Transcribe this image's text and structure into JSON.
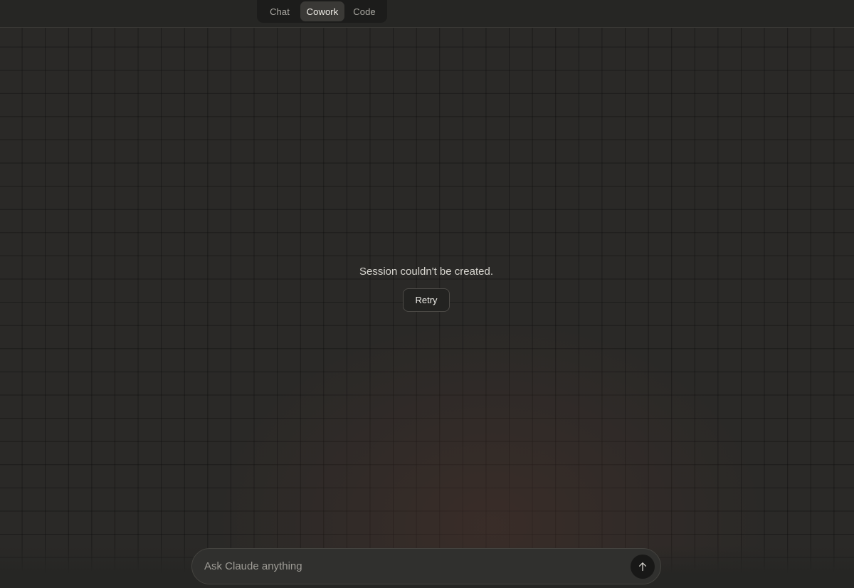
{
  "header": {
    "mode_tabs": [
      {
        "label": "Chat",
        "active": false
      },
      {
        "label": "Cowork",
        "active": true
      },
      {
        "label": "Code",
        "active": false
      }
    ]
  },
  "main": {
    "error_message": "Session couldn't be created.",
    "retry_label": "Retry"
  },
  "composer": {
    "placeholder": "Ask Claude anything",
    "value": "",
    "send_icon": "arrow-up-icon"
  },
  "colors": {
    "background": "#262624",
    "active_tab": "#3a3936",
    "send_button": "#181817"
  }
}
